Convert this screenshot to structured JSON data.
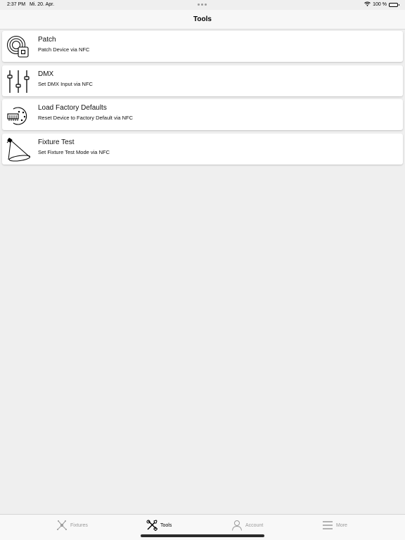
{
  "status_bar": {
    "time": "2:37 PM",
    "date": "Mi. 20. Apr.",
    "battery": "100 %"
  },
  "nav": {
    "title": "Tools"
  },
  "tools": [
    {
      "title": "Patch",
      "subtitle": "Patch Device via NFC",
      "icon": "patch-nfc-icon"
    },
    {
      "title": "DMX",
      "subtitle": "Set DMX Input via NFC",
      "icon": "dmx-sliders-icon"
    },
    {
      "title": "Load Factory Defaults",
      "subtitle": "Reset Device to Factory Default via NFC",
      "icon": "factory-defaults-icon"
    },
    {
      "title": "Fixture Test",
      "subtitle": "Set Fixture Test Mode via NFC",
      "icon": "fixture-spotlight-icon"
    }
  ],
  "tab_bar": {
    "items": [
      {
        "label": "Fixtures",
        "icon": "fixtures-icon",
        "active": false
      },
      {
        "label": "Tools",
        "icon": "tools-icon",
        "active": true
      },
      {
        "label": "Account",
        "icon": "account-icon",
        "active": false
      },
      {
        "label": "More",
        "icon": "menu-icon",
        "active": false
      }
    ]
  },
  "colors": {
    "background": "#efefef",
    "card": "#ffffff",
    "tab_inactive": "#9a9a9a",
    "tab_active": "#000000"
  }
}
